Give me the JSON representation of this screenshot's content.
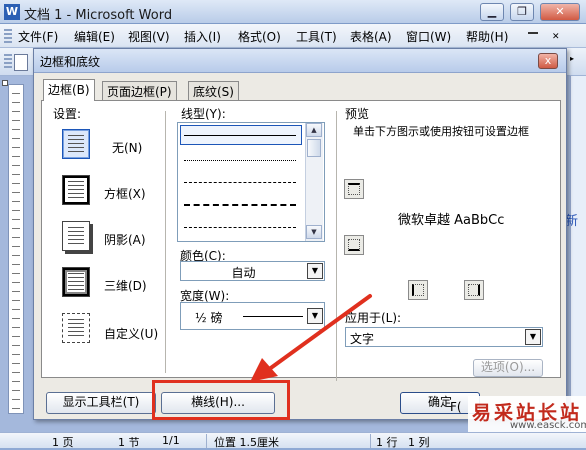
{
  "window": {
    "title": "文档 1 - Microsoft Word",
    "icon_letter": "W",
    "min_icon": "minimize-icon",
    "max_icon": "restore-icon",
    "close_icon": "close-icon"
  },
  "menu": [
    "文件(F)",
    "编辑(E)",
    "视图(V)",
    "插入(I)",
    "格式(O)",
    "工具(T)",
    "表格(A)",
    "窗口(W)",
    "帮助(H)"
  ],
  "side_partial_text": "新",
  "dialog": {
    "title": "边框和底纹",
    "close_label": "x",
    "tabs": [
      "边框(B)",
      "页面边框(P)",
      "底纹(S)"
    ],
    "settings_label": "设置:",
    "settings": [
      "无(N)",
      "方框(X)",
      "阴影(A)",
      "三维(D)",
      "自定义(U)"
    ],
    "line_style_label": "线型(Y):",
    "color_label": "颜色(C):",
    "color_value": "自动",
    "width_label": "宽度(W):",
    "width_value": "½ 磅",
    "preview_label": "预览",
    "preview_hint": "单击下方图示或使用按钮可设置边框",
    "preview_sample": "微软卓越  AaBbCc",
    "apply_to_label": "应用于(L):",
    "apply_to_value": "文字",
    "options_button": "选项(O)...",
    "show_toolbar_button": "显示工具栏(T)",
    "horizontal_line_button": "横线(H)...",
    "ok_button": "确定"
  },
  "partial_ok_text": "F(",
  "status": {
    "page": "1 页",
    "section": "1 节",
    "page_of": "1/1",
    "position": "位置 1.5厘米",
    "row": "1 行",
    "col": "1 列"
  },
  "watermark": {
    "main": "易采站长站",
    "sub": "www.easck.com"
  },
  "colors": {
    "highlight": "#e0301e",
    "arrow": "#e0301e"
  }
}
